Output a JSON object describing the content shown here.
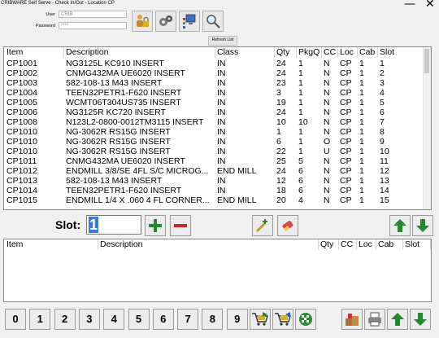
{
  "window": {
    "title": "CRIBWARE Self Serve - Check In/Out - Location CP",
    "minimize_glyph": "—",
    "close_glyph": "✕"
  },
  "login": {
    "user_label": "User",
    "user_value": "CRIB",
    "password_label": "Password",
    "password_value": "****"
  },
  "toolbar": {
    "icons": [
      "lock-person-icon",
      "gears-icon",
      "computer-tree-icon",
      "magnifier-icon"
    ],
    "refresh_label": "Refresh List"
  },
  "inventory": {
    "columns": [
      "Item",
      "Description",
      "Class",
      "Qty",
      "PkgQ",
      "CC",
      "Loc",
      "Cab",
      "Slot"
    ],
    "rows": [
      [
        "CP1001",
        "NG3125L KC910 INSERT",
        "IN",
        "24",
        "1",
        "N",
        "CP",
        "1",
        "1"
      ],
      [
        "CP1002",
        "CNMG432MA UE6020 INSERT",
        "IN",
        "24",
        "1",
        "N",
        "CP",
        "1",
        "2"
      ],
      [
        "CP1003",
        "582-108-13 M43 INSERT",
        "IN",
        "23",
        "1",
        "N",
        "CP",
        "1",
        "3"
      ],
      [
        "CP1004",
        "TEEN32PETR1-F620 INSERT",
        "IN",
        "3",
        "1",
        "N",
        "CP",
        "1",
        "4"
      ],
      [
        "CP1005",
        "WCMT06T304US735 INSERT",
        "IN",
        "19",
        "1",
        "N",
        "CP",
        "1",
        "5"
      ],
      [
        "CP1006",
        "NG3125R KC720 INSERT",
        "IN",
        "24",
        "1",
        "N",
        "CP",
        "1",
        "6"
      ],
      [
        "CP1008",
        "N123L2-0800-0012TM3115 INSERT",
        "IN",
        "10",
        "10",
        "N",
        "CP",
        "1",
        "7"
      ],
      [
        "CP1010",
        "NG-3062R RS15G INSERT",
        "IN",
        "1",
        "1",
        "N",
        "CP",
        "1",
        "8"
      ],
      [
        "CP1010",
        "NG-3062R RS15G INSERT",
        "IN",
        "6",
        "1",
        "O",
        "CP",
        "1",
        "9"
      ],
      [
        "CP1010",
        "NG-3062R RS15G INSERT",
        "IN",
        "22",
        "1",
        "U",
        "CP",
        "1",
        "10"
      ],
      [
        "CP1011",
        "CNMG432MA UE6020 INSERT",
        "IN",
        "25",
        "5",
        "N",
        "CP",
        "1",
        "11"
      ],
      [
        "CP1012",
        "ENDMILL 3/8/SE 4FL S/C MICROG...",
        "END MILL",
        "24",
        "6",
        "N",
        "CP",
        "1",
        "12"
      ],
      [
        "CP1013",
        "582-108-13 M43 INSERT",
        "IN",
        "12",
        "6",
        "N",
        "CP",
        "1",
        "13"
      ],
      [
        "CP1014",
        "TEEN32PETR1-F620 INSERT",
        "IN",
        "18",
        "6",
        "N",
        "CP",
        "1",
        "14"
      ],
      [
        "CP1015",
        "ENDMILL 1/4 X .060 4 FL CORNER...",
        "END MILL",
        "20",
        "4",
        "N",
        "CP",
        "1",
        "15"
      ]
    ]
  },
  "slot": {
    "label": "Slot:",
    "value": "1"
  },
  "transaction": {
    "columns": [
      "Item",
      "Description",
      "Qty",
      "CC",
      "Loc",
      "Cab",
      "Slot"
    ]
  },
  "keypad": {
    "digits": [
      "0",
      "1",
      "2",
      "3",
      "4",
      "5",
      "6",
      "7",
      "8",
      "9"
    ]
  },
  "colors": {
    "plus": "#1f8a2e",
    "minus": "#d42020",
    "arrow": "#1f8a2e"
  }
}
